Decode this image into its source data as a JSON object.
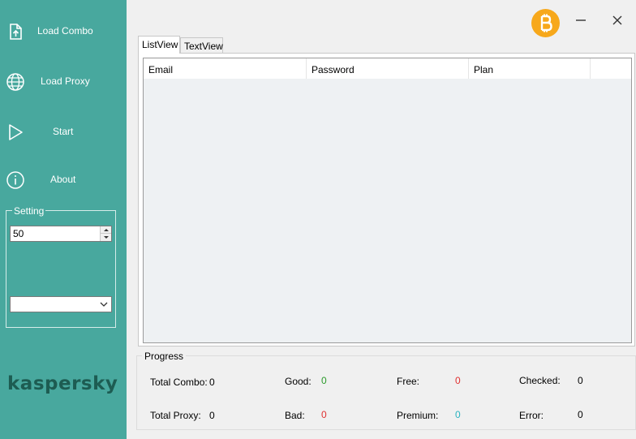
{
  "sidebar": {
    "load_combo": {
      "label": "Load Combo",
      "icon": "upload-file-icon"
    },
    "load_proxy": {
      "label": "Load Proxy",
      "icon": "globe-icon"
    },
    "start": {
      "label": "Start",
      "icon": "play-icon"
    },
    "about": {
      "label": "About",
      "icon": "info-icon"
    },
    "setting": {
      "title": "Setting",
      "threads_value": "50",
      "dropdown_value": ""
    },
    "logo_text": "kaspersky"
  },
  "window": {
    "bitcoin_icon": "bitcoin-icon",
    "minimize_icon": "minimize-icon",
    "close_icon": "close-icon"
  },
  "tabs": [
    {
      "label": "ListView",
      "active": true
    },
    {
      "label": "TextView",
      "active": false
    }
  ],
  "listview": {
    "columns": [
      "Email",
      "Password",
      "Plan",
      ""
    ],
    "rows": []
  },
  "progress": {
    "title": "Progress",
    "total_combo": {
      "label": "Total Combo:",
      "value": "0"
    },
    "total_proxy": {
      "label": "Total Proxy:",
      "value": "0"
    },
    "good": {
      "label": "Good:",
      "value": "0"
    },
    "bad": {
      "label": "Bad:",
      "value": "0"
    },
    "free": {
      "label": "Free:",
      "value": "0"
    },
    "premium": {
      "label": "Premium:",
      "value": "0"
    },
    "checked": {
      "label": "Checked:",
      "value": "0"
    },
    "error": {
      "label": "Error:",
      "value": "0"
    }
  },
  "colors": {
    "sidebar_bg": "#48a89e",
    "logo": "#1d5c52",
    "bitcoin": "#f7a81b",
    "good": "#2a9a2a",
    "bad": "#e03030",
    "free": "#e03030",
    "premium": "#2bb3c0"
  }
}
